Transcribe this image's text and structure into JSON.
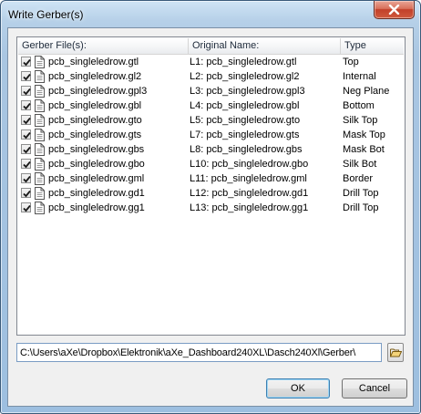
{
  "window": {
    "title": "Write Gerber(s)"
  },
  "list": {
    "columns": [
      "Gerber File(s):",
      "Original Name:",
      "Type"
    ],
    "rows": [
      {
        "checked": true,
        "file": "pcb_singleledrow.gtl",
        "original": "L1: pcb_singleledrow.gtl",
        "type": "Top"
      },
      {
        "checked": true,
        "file": "pcb_singleledrow.gl2",
        "original": "L2: pcb_singleledrow.gl2",
        "type": "Internal"
      },
      {
        "checked": true,
        "file": "pcb_singleledrow.gpl3",
        "original": "L3: pcb_singleledrow.gpl3",
        "type": "Neg Plane"
      },
      {
        "checked": true,
        "file": "pcb_singleledrow.gbl",
        "original": "L4: pcb_singleledrow.gbl",
        "type": "Bottom"
      },
      {
        "checked": true,
        "file": "pcb_singleledrow.gto",
        "original": "L5: pcb_singleledrow.gto",
        "type": "Silk Top"
      },
      {
        "checked": true,
        "file": "pcb_singleledrow.gts",
        "original": "L7: pcb_singleledrow.gts",
        "type": "Mask Top"
      },
      {
        "checked": true,
        "file": "pcb_singleledrow.gbs",
        "original": "L8: pcb_singleledrow.gbs",
        "type": "Mask Bot"
      },
      {
        "checked": true,
        "file": "pcb_singleledrow.gbo",
        "original": "L10: pcb_singleledrow.gbo",
        "type": "Silk Bot"
      },
      {
        "checked": true,
        "file": "pcb_singleledrow.gml",
        "original": "L11: pcb_singleledrow.gml",
        "type": "Border"
      },
      {
        "checked": true,
        "file": "pcb_singleledrow.gd1",
        "original": "L12: pcb_singleledrow.gd1",
        "type": "Drill Top"
      },
      {
        "checked": true,
        "file": "pcb_singleledrow.gg1",
        "original": "L13: pcb_singleledrow.gg1",
        "type": "Drill Top"
      }
    ]
  },
  "output_path": {
    "value": "C:\\Users\\aXe\\Dropbox\\Elektronik\\aXe_Dashboard240XL\\Dasch240Xl\\Gerber\\"
  },
  "icons": {
    "close": "close-icon",
    "file": "document-icon",
    "check": "check-icon",
    "browse": "folder-open-icon"
  },
  "buttons": {
    "ok": "OK",
    "cancel": "Cancel"
  }
}
